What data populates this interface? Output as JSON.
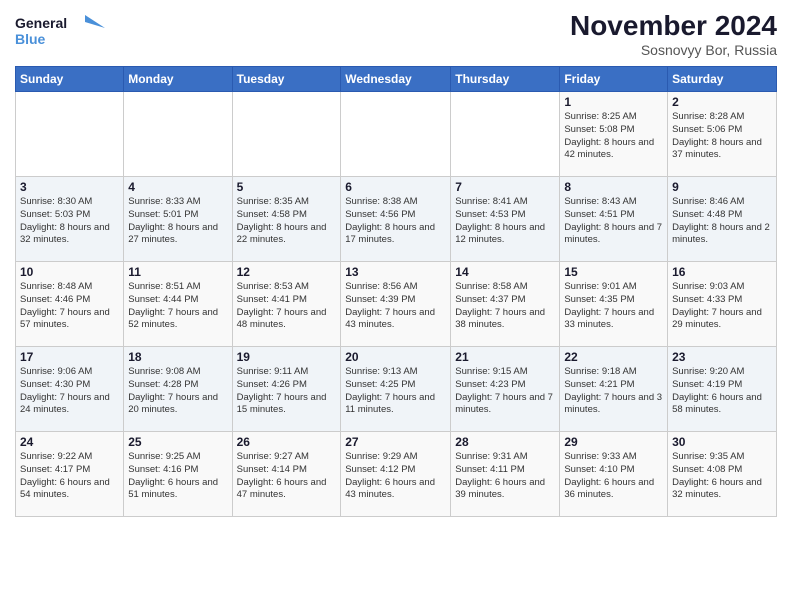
{
  "header": {
    "logo_line1": "General",
    "logo_line2": "Blue",
    "title": "November 2024",
    "subtitle": "Sosnovyy Bor, Russia"
  },
  "days_of_week": [
    "Sunday",
    "Monday",
    "Tuesday",
    "Wednesday",
    "Thursday",
    "Friday",
    "Saturday"
  ],
  "weeks": [
    [
      {
        "day": "",
        "info": ""
      },
      {
        "day": "",
        "info": ""
      },
      {
        "day": "",
        "info": ""
      },
      {
        "day": "",
        "info": ""
      },
      {
        "day": "",
        "info": ""
      },
      {
        "day": "1",
        "info": "Sunrise: 8:25 AM\nSunset: 5:08 PM\nDaylight: 8 hours and 42 minutes."
      },
      {
        "day": "2",
        "info": "Sunrise: 8:28 AM\nSunset: 5:06 PM\nDaylight: 8 hours and 37 minutes."
      }
    ],
    [
      {
        "day": "3",
        "info": "Sunrise: 8:30 AM\nSunset: 5:03 PM\nDaylight: 8 hours and 32 minutes."
      },
      {
        "day": "4",
        "info": "Sunrise: 8:33 AM\nSunset: 5:01 PM\nDaylight: 8 hours and 27 minutes."
      },
      {
        "day": "5",
        "info": "Sunrise: 8:35 AM\nSunset: 4:58 PM\nDaylight: 8 hours and 22 minutes."
      },
      {
        "day": "6",
        "info": "Sunrise: 8:38 AM\nSunset: 4:56 PM\nDaylight: 8 hours and 17 minutes."
      },
      {
        "day": "7",
        "info": "Sunrise: 8:41 AM\nSunset: 4:53 PM\nDaylight: 8 hours and 12 minutes."
      },
      {
        "day": "8",
        "info": "Sunrise: 8:43 AM\nSunset: 4:51 PM\nDaylight: 8 hours and 7 minutes."
      },
      {
        "day": "9",
        "info": "Sunrise: 8:46 AM\nSunset: 4:48 PM\nDaylight: 8 hours and 2 minutes."
      }
    ],
    [
      {
        "day": "10",
        "info": "Sunrise: 8:48 AM\nSunset: 4:46 PM\nDaylight: 7 hours and 57 minutes."
      },
      {
        "day": "11",
        "info": "Sunrise: 8:51 AM\nSunset: 4:44 PM\nDaylight: 7 hours and 52 minutes."
      },
      {
        "day": "12",
        "info": "Sunrise: 8:53 AM\nSunset: 4:41 PM\nDaylight: 7 hours and 48 minutes."
      },
      {
        "day": "13",
        "info": "Sunrise: 8:56 AM\nSunset: 4:39 PM\nDaylight: 7 hours and 43 minutes."
      },
      {
        "day": "14",
        "info": "Sunrise: 8:58 AM\nSunset: 4:37 PM\nDaylight: 7 hours and 38 minutes."
      },
      {
        "day": "15",
        "info": "Sunrise: 9:01 AM\nSunset: 4:35 PM\nDaylight: 7 hours and 33 minutes."
      },
      {
        "day": "16",
        "info": "Sunrise: 9:03 AM\nSunset: 4:33 PM\nDaylight: 7 hours and 29 minutes."
      }
    ],
    [
      {
        "day": "17",
        "info": "Sunrise: 9:06 AM\nSunset: 4:30 PM\nDaylight: 7 hours and 24 minutes."
      },
      {
        "day": "18",
        "info": "Sunrise: 9:08 AM\nSunset: 4:28 PM\nDaylight: 7 hours and 20 minutes."
      },
      {
        "day": "19",
        "info": "Sunrise: 9:11 AM\nSunset: 4:26 PM\nDaylight: 7 hours and 15 minutes."
      },
      {
        "day": "20",
        "info": "Sunrise: 9:13 AM\nSunset: 4:25 PM\nDaylight: 7 hours and 11 minutes."
      },
      {
        "day": "21",
        "info": "Sunrise: 9:15 AM\nSunset: 4:23 PM\nDaylight: 7 hours and 7 minutes."
      },
      {
        "day": "22",
        "info": "Sunrise: 9:18 AM\nSunset: 4:21 PM\nDaylight: 7 hours and 3 minutes."
      },
      {
        "day": "23",
        "info": "Sunrise: 9:20 AM\nSunset: 4:19 PM\nDaylight: 6 hours and 58 minutes."
      }
    ],
    [
      {
        "day": "24",
        "info": "Sunrise: 9:22 AM\nSunset: 4:17 PM\nDaylight: 6 hours and 54 minutes."
      },
      {
        "day": "25",
        "info": "Sunrise: 9:25 AM\nSunset: 4:16 PM\nDaylight: 6 hours and 51 minutes."
      },
      {
        "day": "26",
        "info": "Sunrise: 9:27 AM\nSunset: 4:14 PM\nDaylight: 6 hours and 47 minutes."
      },
      {
        "day": "27",
        "info": "Sunrise: 9:29 AM\nSunset: 4:12 PM\nDaylight: 6 hours and 43 minutes."
      },
      {
        "day": "28",
        "info": "Sunrise: 9:31 AM\nSunset: 4:11 PM\nDaylight: 6 hours and 39 minutes."
      },
      {
        "day": "29",
        "info": "Sunrise: 9:33 AM\nSunset: 4:10 PM\nDaylight: 6 hours and 36 minutes."
      },
      {
        "day": "30",
        "info": "Sunrise: 9:35 AM\nSunset: 4:08 PM\nDaylight: 6 hours and 32 minutes."
      }
    ]
  ]
}
